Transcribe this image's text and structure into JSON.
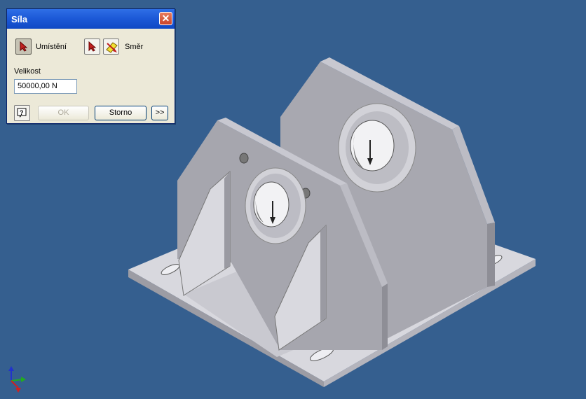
{
  "dialog": {
    "title": "Síla",
    "placement_label": "Umístění",
    "direction_label": "Směr",
    "magnitude_label": "Velikost",
    "magnitude_value": "50000,00 N",
    "ok_label": "OK",
    "cancel_label": "Storno",
    "more_label": ">>",
    "close_label": "✕"
  },
  "icons": {
    "placement": "select-arrow-icon",
    "direction_select": "select-arrow-icon",
    "direction_flip": "flip-direction-icon",
    "help": "help-icon",
    "triad": "axis-triad-icon"
  },
  "colors": {
    "background": "#355f8f",
    "title_bar": "#1d5ad8",
    "dialog_face": "#ece9d8"
  }
}
